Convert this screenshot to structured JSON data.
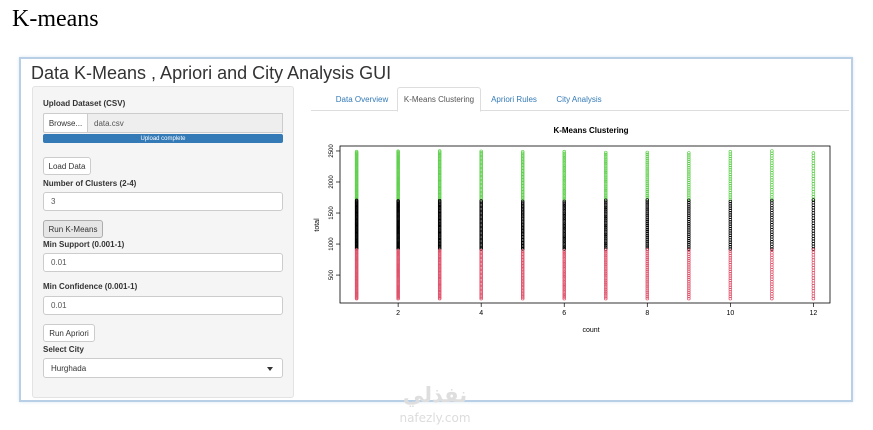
{
  "doc_heading": "K-means",
  "app": {
    "title": "Data K-Means , Apriori and City Analysis GUI"
  },
  "sidebar": {
    "upload_label": "Upload Dataset (CSV)",
    "browse_label": "Browse...",
    "file_name": "data.csv",
    "upload_status": "Upload complete",
    "upload_progress": 1.0,
    "load_button": "Load Data",
    "clusters_label": "Number of Clusters (2-4)",
    "clusters_value": "3",
    "run_kmeans_button": "Run K-Means",
    "support_label": "Min Support (0.001-1)",
    "support_value": "0.01",
    "confidence_label": "Min Confidence (0.001-1)",
    "confidence_value": "0.01",
    "run_apriori_button": "Run Apriori",
    "city_label": "Select City",
    "city_value": "Hurghada"
  },
  "tabs": [
    {
      "label": "Data Overview",
      "active": false
    },
    {
      "label": "K-Means Clustering",
      "active": true
    },
    {
      "label": "Apriori Rules",
      "active": false
    },
    {
      "label": "City Analysis",
      "active": false
    }
  ],
  "colors": {
    "accent": "#337ab7",
    "cluster_high": "#61d04f",
    "cluster_mid": "#000000",
    "cluster_low": "#df536b"
  },
  "watermark": {
    "arabic": "نفذلي",
    "latin": "nafezly.com"
  },
  "chart_data": {
    "type": "scatter",
    "title": "K-Means Clustering",
    "xlabel": "count",
    "ylabel": "total",
    "xlim": [
      0.6,
      12.4
    ],
    "ylim": [
      50,
      2580
    ],
    "xticks": [
      2,
      4,
      6,
      8,
      10,
      12
    ],
    "yticks": [
      500,
      1000,
      1500,
      2000,
      2500
    ],
    "grid": false,
    "x": [
      1,
      2,
      3,
      4,
      5,
      6,
      7,
      8,
      9,
      10,
      11,
      12
    ],
    "clusters": [
      {
        "color": "#61d04f",
        "y_range": [
          1720,
          2500
        ]
      },
      {
        "color": "#000000",
        "y_range": [
          920,
          1710
        ]
      },
      {
        "color": "#df536b",
        "y_range": [
          120,
          910
        ]
      }
    ]
  }
}
